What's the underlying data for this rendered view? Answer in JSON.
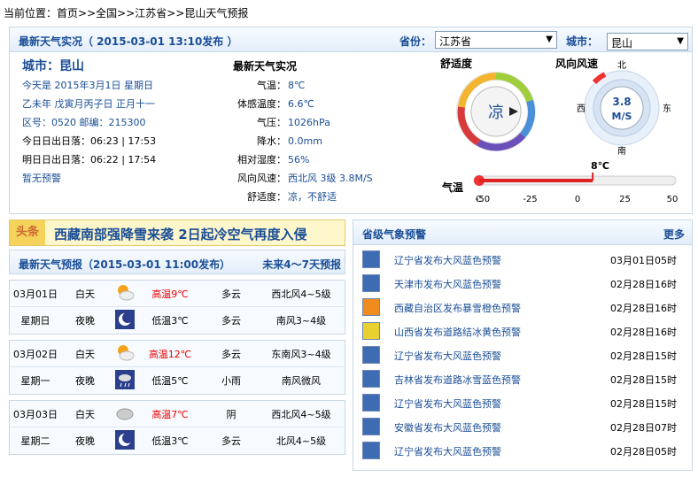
{
  "breadcrumb": {
    "prefix": "当前位置：",
    "items": [
      "首页",
      ">>全国",
      ">>江苏省",
      ">>昆山天气预报"
    ]
  },
  "live": {
    "title": "最新天气实况（ 2015-03-01  13:10发布 ）",
    "province_label": "省份：",
    "province_value": "江苏省",
    "city_label": "城市：",
    "city_value": "昆山"
  },
  "info": {
    "city": "城市：昆山",
    "today": "今天是  2015年3月1日  星期日",
    "lunar": "乙未年  戊寅月丙子日  正月十一",
    "codes": "区号：0520   邮编：215300",
    "sun_today": "今日日出日落：06:23  | 17:53",
    "sun_tomorrow": "明日日出日落：06:22  | 17:54",
    "alert": "暂无预警"
  },
  "obs": {
    "title": "最新天气实况",
    "rows": [
      {
        "k": "气温：",
        "v": "8℃"
      },
      {
        "k": "体感温度：",
        "v": "6.6℃"
      },
      {
        "k": "气压：",
        "v": "1026hPa"
      },
      {
        "k": "降水：",
        "v": "0.0mm"
      },
      {
        "k": "相对湿度：",
        "v": "56%"
      },
      {
        "k": "风向风速：",
        "v": "西北风  3级  3.8M/S"
      },
      {
        "k": "舒适度：",
        "v": "凉，不舒适"
      }
    ]
  },
  "gauges": {
    "comfort_label": "舒适度",
    "comfort_value": "凉",
    "wind_label": "风向风速",
    "wind_value": "3.8",
    "wind_unit": "M/S",
    "dirs": {
      "n": "北",
      "s": "南",
      "e": "东",
      "w": "西"
    },
    "temp_label": "气温",
    "temp_value": "8℃",
    "temp_unit": "C",
    "temp_ticks": [
      "-50",
      "-25",
      "0",
      "25",
      "50"
    ],
    "temp_current": 8,
    "temp_range": [
      -50,
      50
    ]
  },
  "headline": {
    "tag": "头条",
    "text": "西藏南部强降雪来袭  2日起冷空气再度入侵"
  },
  "forecast": {
    "title": "最新天气预报（2015-03-01  11:00发布）",
    "more": "未来4～7天预报",
    "days": [
      {
        "date": "03月01日",
        "week": "星期日",
        "day": {
          "period": "白天",
          "icon": "partly-cloudy-icon",
          "temp": "高温9℃",
          "weather": "多云",
          "wind": "西北风4~5级"
        },
        "night": {
          "period": "夜晚",
          "icon": "moon-icon",
          "temp": "低温3℃",
          "weather": "多云",
          "wind": "南风3~4级"
        }
      },
      {
        "date": "03月02日",
        "week": "星期一",
        "day": {
          "period": "白天",
          "icon": "partly-cloudy-icon",
          "temp": "高温12℃",
          "weather": "多云",
          "wind": "东南风3~4级"
        },
        "night": {
          "period": "夜晚",
          "icon": "night-rain-icon",
          "temp": "低温5℃",
          "weather": "小雨",
          "wind": "南风微风"
        }
      },
      {
        "date": "03月03日",
        "week": "星期二",
        "day": {
          "period": "白天",
          "icon": "cloudy-icon",
          "temp": "高温7℃",
          "weather": "阴",
          "wind": "西北风4~5级"
        },
        "night": {
          "period": "夜晚",
          "icon": "moon-icon",
          "temp": "低温3℃",
          "weather": "多云",
          "wind": "北风4~5级"
        }
      }
    ]
  },
  "warnings": {
    "title": "省级气象预警",
    "more": "更多",
    "items": [
      {
        "text": "辽宁省发布大风蓝色预警",
        "time": "03月01日05时",
        "color": "#3e6cb3"
      },
      {
        "text": "天津市发布大风蓝色预警",
        "time": "02月28日16时",
        "color": "#3e6cb3"
      },
      {
        "text": "西藏自治区发布暴雪橙色预警",
        "time": "02月28日16时",
        "color": "#f08c1e"
      },
      {
        "text": "山西省发布道路结冰黄色预警",
        "time": "02月28日16时",
        "color": "#e8d030"
      },
      {
        "text": "辽宁省发布大风蓝色预警",
        "time": "02月28日15时",
        "color": "#3e6cb3"
      },
      {
        "text": "吉林省发布道路冰雪蓝色预警",
        "time": "02月28日15时",
        "color": "#3e6cb3"
      },
      {
        "text": "辽宁省发布大风蓝色预警",
        "time": "02月28日15时",
        "color": "#3e6cb3"
      },
      {
        "text": "安徽省发布大风蓝色预警",
        "time": "02月28日07时",
        "color": "#3e6cb3"
      },
      {
        "text": "辽宁省发布大风蓝色预警",
        "time": "02月28日05时",
        "color": "#3e6cb3"
      }
    ]
  }
}
